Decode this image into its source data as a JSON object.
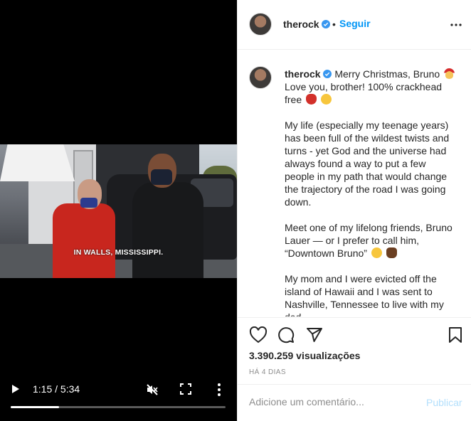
{
  "video": {
    "caption": "IN WALLS, MISSISSIPPI.",
    "time": "1:15 / 5:34",
    "progress_fraction": 0.225
  },
  "post": {
    "username": "therock",
    "follow_label": "Seguir",
    "dot": "•",
    "caption_first": "Merry Christmas, Bruno",
    "caption_line2": "Love you, brother! 100% crackhead free",
    "paragraph1": "My life (especially my teenage years) has been full of the wildest twists and turns - yet God and the universe had always found a way to put a few people in my path that would change the trajectory of the road I was going down.",
    "paragraph2": "Meet one of my lifelong friends, Bruno Lauer — or I prefer to call him, “Downtown Bruno”",
    "paragraph3": "My mom and I were evicted off the island of Hawaii and I was sent to Nashville, Tennessee to live with my dad.",
    "views": "3.390.259 visualizações",
    "time_ago": "HÁ 4 DIAS"
  },
  "comment": {
    "placeholder": "Adicione um comentário...",
    "publish_label": "Publicar"
  },
  "icons": {
    "verified": "verified-badge-icon",
    "more_horizontal": "more-horizontal-icon",
    "heart": "heart-icon",
    "comment": "comment-icon",
    "share": "share-icon",
    "bookmark": "bookmark-icon",
    "play": "play-icon",
    "mute": "mute-icon",
    "fullscreen": "fullscreen-icon",
    "more_vertical": "more-vertical-icon"
  },
  "colors": {
    "accent": "#0095f6",
    "publish_disabled": "#b2dffc",
    "secondary_text": "#8e8e8e",
    "video_bg": "#000000"
  }
}
